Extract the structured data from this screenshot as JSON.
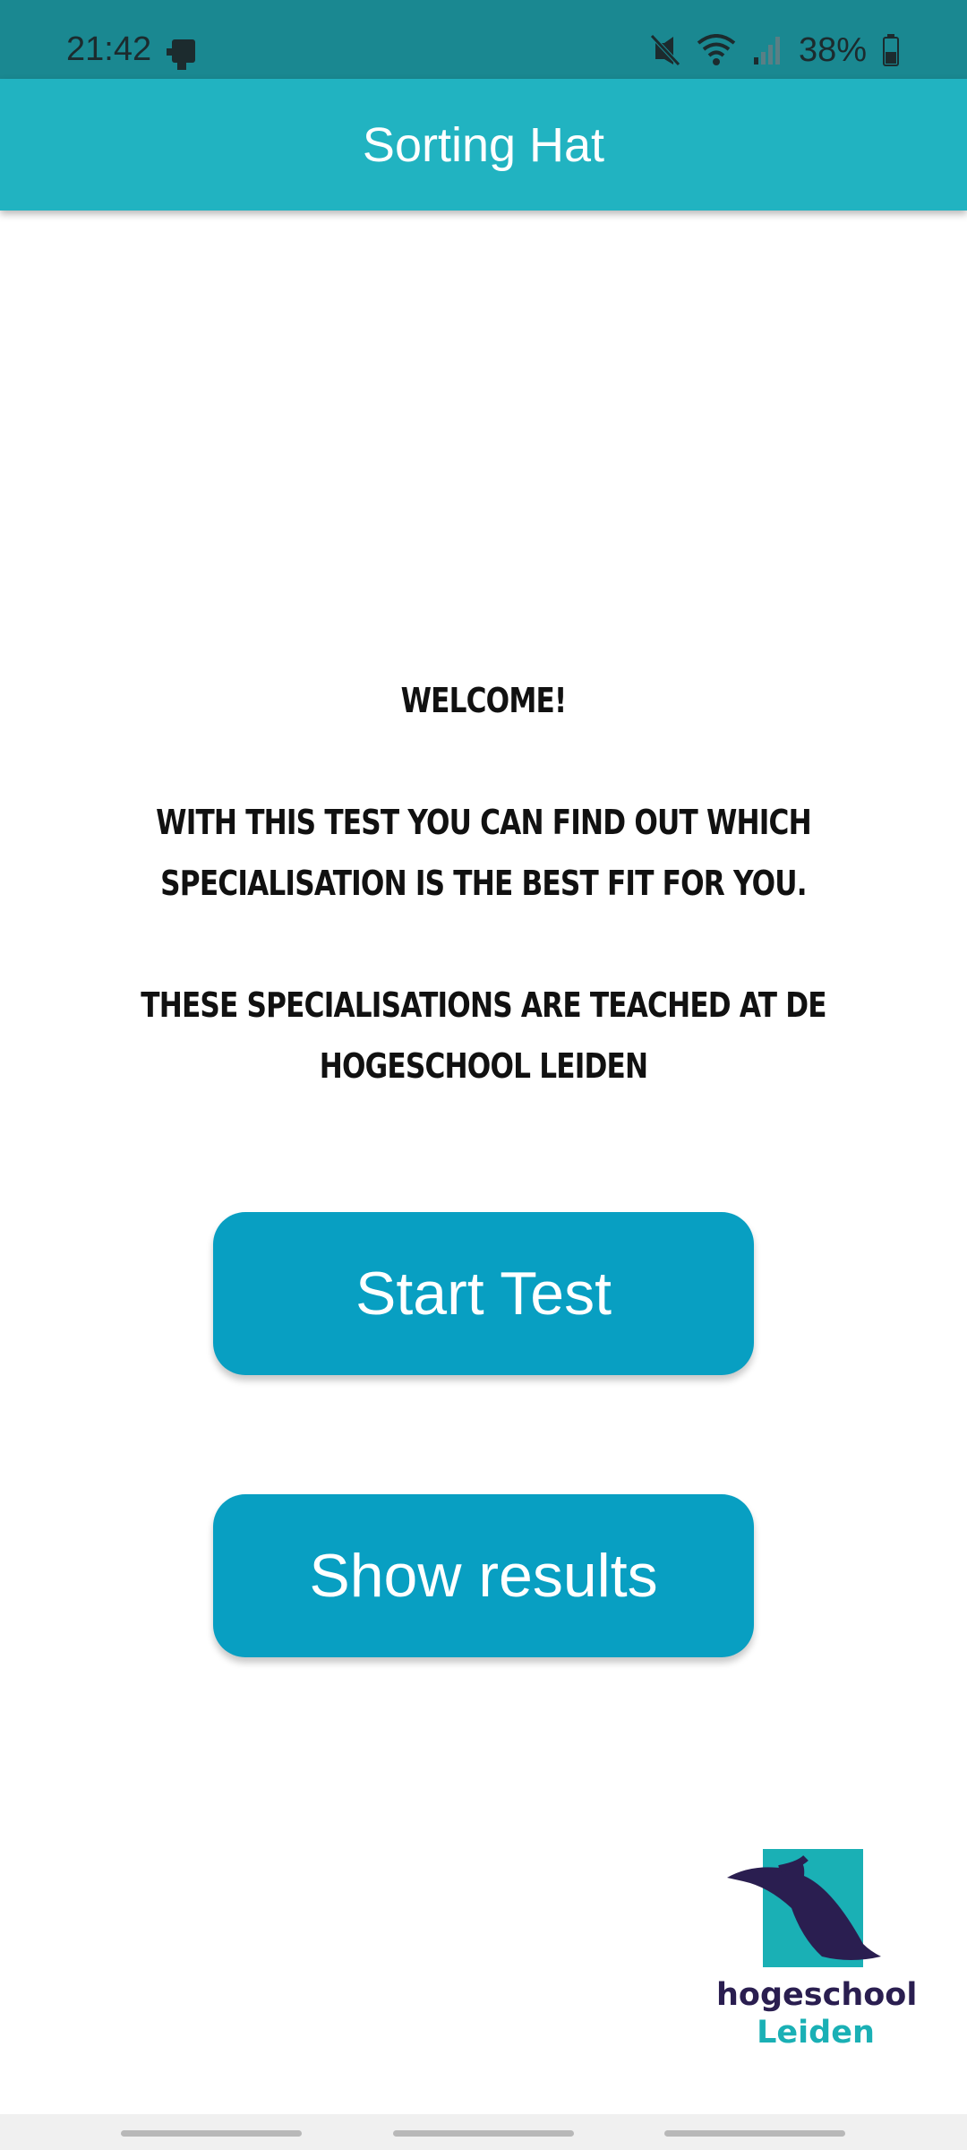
{
  "status_bar": {
    "time": "21:42",
    "battery": "38%",
    "icons": [
      "sim-card-icon",
      "mute-icon",
      "wifi-icon",
      "signal-icon",
      "battery-icon"
    ]
  },
  "app_bar": {
    "title": "Sorting Hat"
  },
  "welcome": {
    "heading": "Welcome!",
    "line1": "With this test you can find out which",
    "line2": "specialisation is the best fit for you.",
    "line3": "These specialisations are teached at de",
    "line4": "Hogeschool Leiden"
  },
  "buttons": {
    "start_label": "Start Test",
    "results_label": "Show results"
  },
  "logo": {
    "word1": "hogeschool",
    "word2": "Leiden"
  },
  "colors": {
    "status_bar": "#1a8891",
    "app_bar": "#21b3c1",
    "button": "#089fc2",
    "logo_dark": "#2a1e50",
    "logo_teal": "#1ab0b5"
  }
}
